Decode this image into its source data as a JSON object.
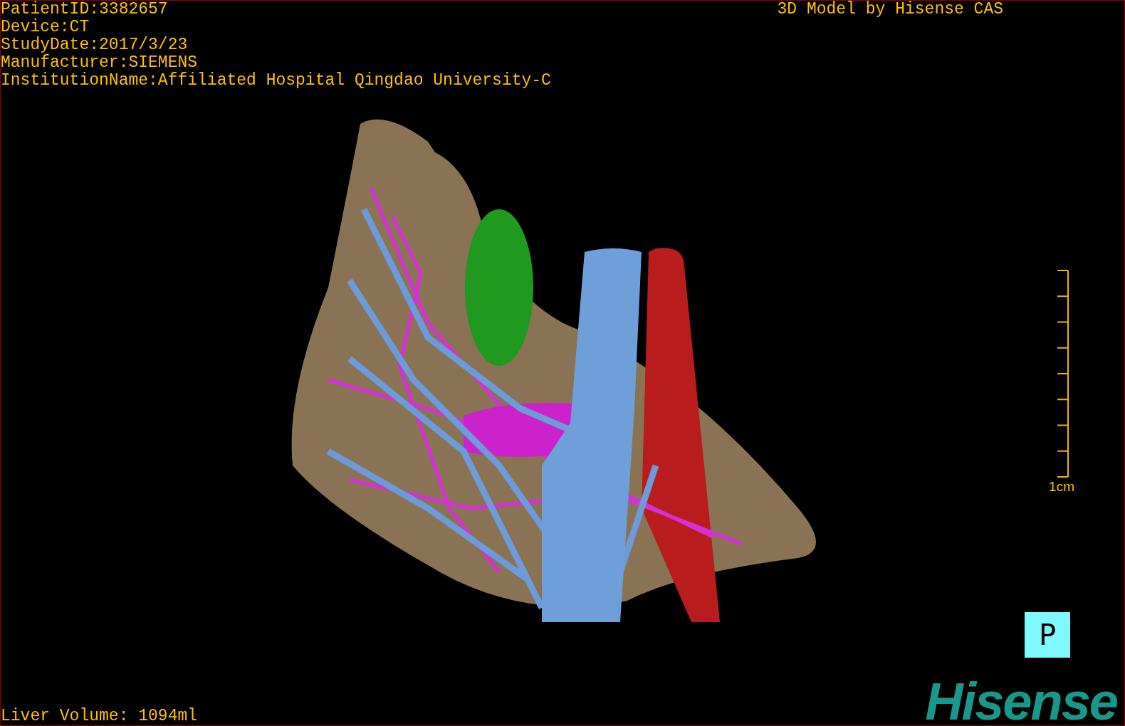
{
  "patient_info": [
    "PatientID:3382657",
    "Device:CT",
    "StudyDate:2017/3/23",
    "Manufacturer:SIEMENS",
    "InstitutionName:Affiliated Hospital Qingdao University-C"
  ],
  "title": "3D Model by Hisense CAS",
  "scale": {
    "label": "1cm"
  },
  "orientation_button": {
    "label": "P"
  },
  "liver_volume": "Liver Volume: 1094ml",
  "logo": "Hisense"
}
